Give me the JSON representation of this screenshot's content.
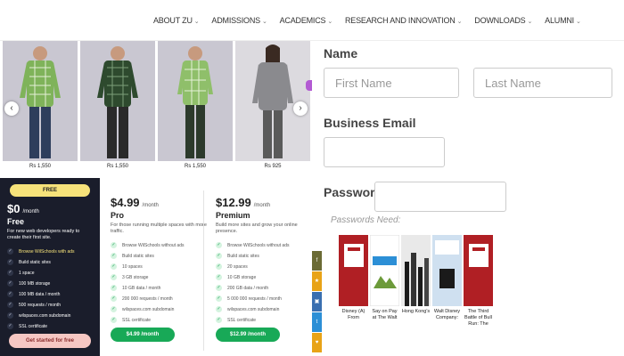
{
  "nav": [
    {
      "label": "ABOUT ZU"
    },
    {
      "label": "ADMISSIONS"
    },
    {
      "label": "ACADEMICS"
    },
    {
      "label": "RESEARCH AND INNOVATION"
    },
    {
      "label": "DOWNLOADS"
    },
    {
      "label": "ALUMNI"
    }
  ],
  "products": [
    {
      "price": "Rs 1,550",
      "shirt": "#7fb35a",
      "pants": "#2e3e5c"
    },
    {
      "price": "Rs 1,550",
      "shirt": "#2e4a2e",
      "pants": "#2a2a2a"
    },
    {
      "price": "Rs 1,550",
      "shirt": "#8fbf6a",
      "pants": "#2c3a2c"
    },
    {
      "price": "Rs 925",
      "shirt": "#8a8a8e",
      "pants": "#5a5a5a"
    }
  ],
  "pricing": {
    "free": {
      "badge": "FREE",
      "price": "$0",
      "period": "/month",
      "name": "Free",
      "desc": "For new web developers ready to create their first site.",
      "features": [
        "Browse WilSchools with ads",
        "Build static sites",
        "1 space",
        "100 MB storage",
        "100 MB data / month",
        "500 requests / month",
        "wilspaces.com subdomain",
        "SSL certificate"
      ],
      "cta": "Get started for free"
    },
    "pro": {
      "price": "$4.99",
      "period": "/month",
      "name": "Pro",
      "desc": "For those running multiple spaces with more traffic.",
      "features": [
        "Browse WilSchools without ads",
        "Build static sites",
        "10 spaces",
        "3 GB storage",
        "10 GB data / month",
        "200 000 requests / month",
        "wilspaces.com subdomain",
        "SSL certificate"
      ],
      "cta": "$4.99 /month"
    },
    "premium": {
      "price": "$12.99",
      "period": "/month",
      "name": "Premium",
      "desc": "Build more sites and grow your online presence.",
      "features": [
        "Browse WilSchools without ads",
        "Build static sites",
        "20 spaces",
        "10 GB storage",
        "200 GB data / month",
        "5 000 000 requests / month",
        "wilspaces.com subdomain",
        "SSL certificate"
      ],
      "cta": "$12.99 /month"
    }
  },
  "form": {
    "name_label": "Name",
    "first_placeholder": "First Name",
    "last_placeholder": "Last Name",
    "email_label": "Business Email",
    "password_label": "Password",
    "password_hint": "Passwords Need:"
  },
  "books": [
    {
      "title": "Disney (A) From",
      "color": "#b01f24"
    },
    {
      "title": "Say on Pay at The Walt",
      "color": "#ffffff"
    },
    {
      "title": "Hong Kong's",
      "color": "#1a1a1a"
    },
    {
      "title": "Walt Disney Company:",
      "color": "#cfe0f0"
    },
    {
      "title": "The Third Battle of Bull Run: The",
      "color": "#b01f24"
    }
  ],
  "colors": {
    "accent_green": "#18a957",
    "free_card": "#1a1d2b",
    "free_badge": "#f6e27a"
  }
}
